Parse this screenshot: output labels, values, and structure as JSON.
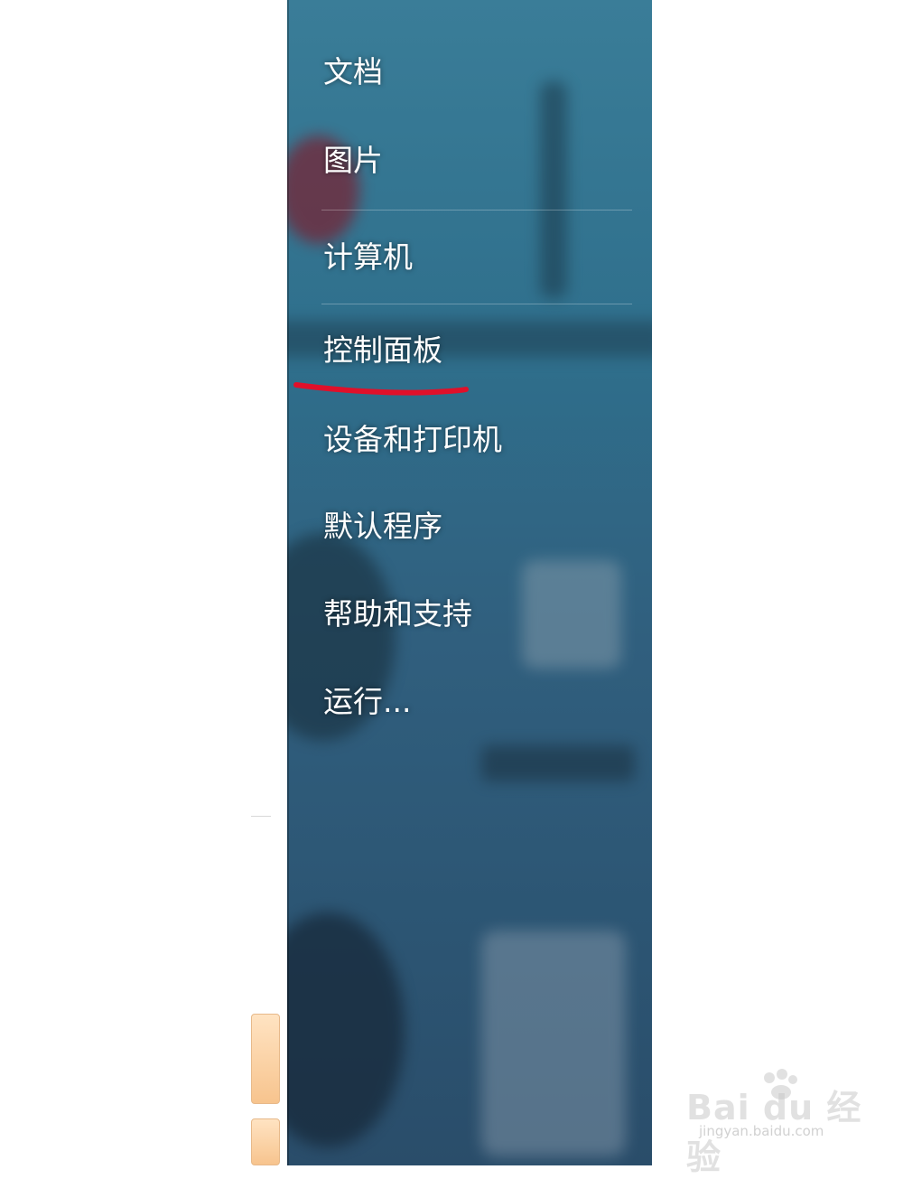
{
  "start_menu": {
    "items": [
      {
        "label": "文档"
      },
      {
        "label": "图片"
      },
      {
        "label": "计算机"
      },
      {
        "label": "控制面板"
      },
      {
        "label": "设备和打印机"
      },
      {
        "label": "默认程序"
      },
      {
        "label": "帮助和支持"
      },
      {
        "label": "运行..."
      }
    ],
    "highlighted_item": "控制面板"
  },
  "colors": {
    "panel_top": "#3a7d98",
    "panel_bottom": "#2a4d6a",
    "menu_text": "#ffffff",
    "annotation_underline": "#e0102a",
    "left_button": "#f7c48e"
  },
  "watermark": {
    "brand": "Bai du 经验",
    "url": "jingyan.baidu.com"
  }
}
